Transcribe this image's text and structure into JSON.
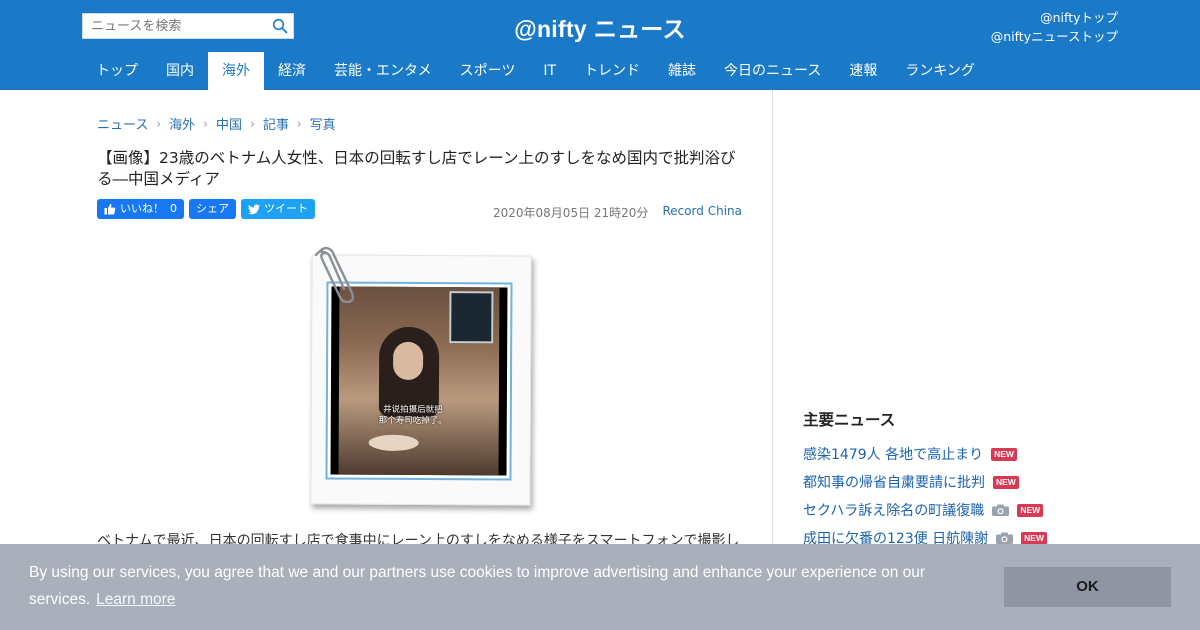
{
  "header": {
    "search_placeholder": "ニュースを検索",
    "logo": "@nifty ニュース",
    "links": [
      "@niftyトップ",
      "@niftyニューストップ"
    ],
    "colors": {
      "header_bg": "#1a7ac8"
    }
  },
  "nav": {
    "tabs": [
      {
        "label": "トップ"
      },
      {
        "label": "国内"
      },
      {
        "label": "海外",
        "active": true
      },
      {
        "label": "経済"
      },
      {
        "label": "芸能・エンタメ"
      },
      {
        "label": "スポーツ"
      },
      {
        "label": "IT"
      },
      {
        "label": "トレンド"
      },
      {
        "label": "雑誌"
      },
      {
        "label": "今日のニュース"
      },
      {
        "label": "速報"
      },
      {
        "label": "ランキング"
      }
    ]
  },
  "article": {
    "breadcrumb": [
      "ニュース",
      "海外",
      "中国",
      "記事",
      "写真"
    ],
    "title": "【画像】23歳のベトナム人女性、日本の回転すし店でレーン上のすしをなめ国内で批判浴びる―中国メディア",
    "share": {
      "like_label": "いいね！",
      "like_count": "0",
      "share_label": "シェア",
      "tweet_label": "ツイート"
    },
    "date": "2020年08月05日 21時20分",
    "source": "Record China",
    "image": {
      "icon": "paperclip-icon",
      "caption_line1": "井说拍摄后就把",
      "caption_line2": "那个寿司吃掉了。"
    },
    "body_start": "ベトナムで最近、日本の回転すし店で食事中にレーン上のすしをなめる様子をスマートフォンで撮影し"
  },
  "sidebar": {
    "title": "主要ニュース",
    "new_badge": "NEW",
    "items": [
      {
        "text": "感染1479人 各地で高止まり",
        "photo": false,
        "new": true
      },
      {
        "text": "都知事の帰省自粛要請に批判",
        "photo": false,
        "new": true
      },
      {
        "text": "セクハラ訴え除名の町議復職",
        "photo": true,
        "new": true
      },
      {
        "text": "成田に欠番の123便 日航陳謝",
        "photo": true,
        "new": true
      }
    ]
  },
  "cookie": {
    "message": "By using our services, you agree that we and our partners use cookies to improve advertising and enhance your experience on our services.",
    "learn_more": "Learn more",
    "ok": "OK"
  }
}
